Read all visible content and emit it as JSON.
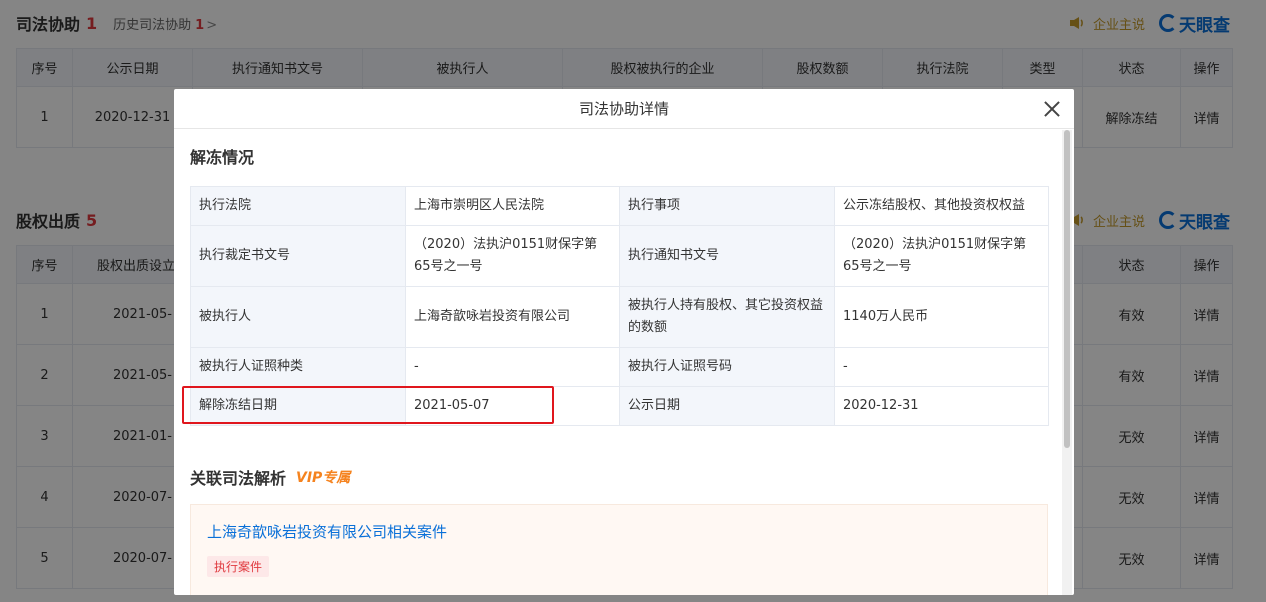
{
  "bg": {
    "section1": {
      "title": "司法协助",
      "count": "1",
      "history_label": "历史司法协助",
      "history_count": "1",
      "history_arrow": ">"
    },
    "brand": {
      "label": "企业主说",
      "logo": "天眼查"
    },
    "table1": {
      "headers": [
        "序号",
        "公示日期",
        "执行通知书文号",
        "被执行人",
        "股权被执行的企业",
        "股权数额",
        "执行法院",
        "类型",
        "状态",
        "操作"
      ],
      "row": {
        "index": "1",
        "date": "2020-12-31",
        "status": "解除冻结",
        "action": "详情"
      }
    },
    "section2": {
      "title": "股权出质",
      "count": "5"
    },
    "table2": {
      "headers": {
        "index": "序号",
        "date": "股权出质设立登",
        "status": "状态",
        "action": "操作"
      },
      "rows": [
        {
          "index": "1",
          "date": "2021-05-",
          "status": "有效",
          "action": "详情"
        },
        {
          "index": "2",
          "date": "2021-05-",
          "status": "有效",
          "action": "详情"
        },
        {
          "index": "3",
          "date": "2021-01-",
          "status": "无效",
          "action": "详情"
        },
        {
          "index": "4",
          "date": "2020-07-",
          "status": "无效",
          "action": "详情"
        },
        {
          "index": "5",
          "date": "2020-07-",
          "status": "无效",
          "action": "详情"
        }
      ]
    }
  },
  "modal": {
    "title": "司法协助详情",
    "section_title": "解冻情况",
    "rows": [
      {
        "l1": "执行法院",
        "v1": "上海市崇明区人民法院",
        "l2": "执行事项",
        "v2": "公示冻结股权、其他投资权权益"
      },
      {
        "l1": "执行裁定书文号",
        "v1": "（2020）法执沪0151财保字第65号之一号",
        "l2": "执行通知书文号",
        "v2": "（2020）法执沪0151财保字第65号之一号"
      },
      {
        "l1": "被执行人",
        "v1": "上海奇歆咏岩投资有限公司",
        "l2": "被执行人持有股权、其它投资权益的数额",
        "v2": "1140万人民币"
      },
      {
        "l1": "被执行人证照种类",
        "v1": "-",
        "l2": "被执行人证照号码",
        "v2": "-"
      },
      {
        "l1": "解除冻结日期",
        "v1": "2021-05-07",
        "l2": "公示日期",
        "v2": "2020-12-31"
      }
    ],
    "vip": {
      "title": "关联司法解析",
      "badge": "VIP专属"
    },
    "case": {
      "title": "上海奇歆咏岩投资有限公司相关案件",
      "tag": "执行案件"
    }
  },
  "colors": {
    "accent": "#0a70d8",
    "danger": "#e0393e",
    "success": "#19a15f",
    "vip": "#f5831f",
    "highlight": "#e0161d"
  }
}
